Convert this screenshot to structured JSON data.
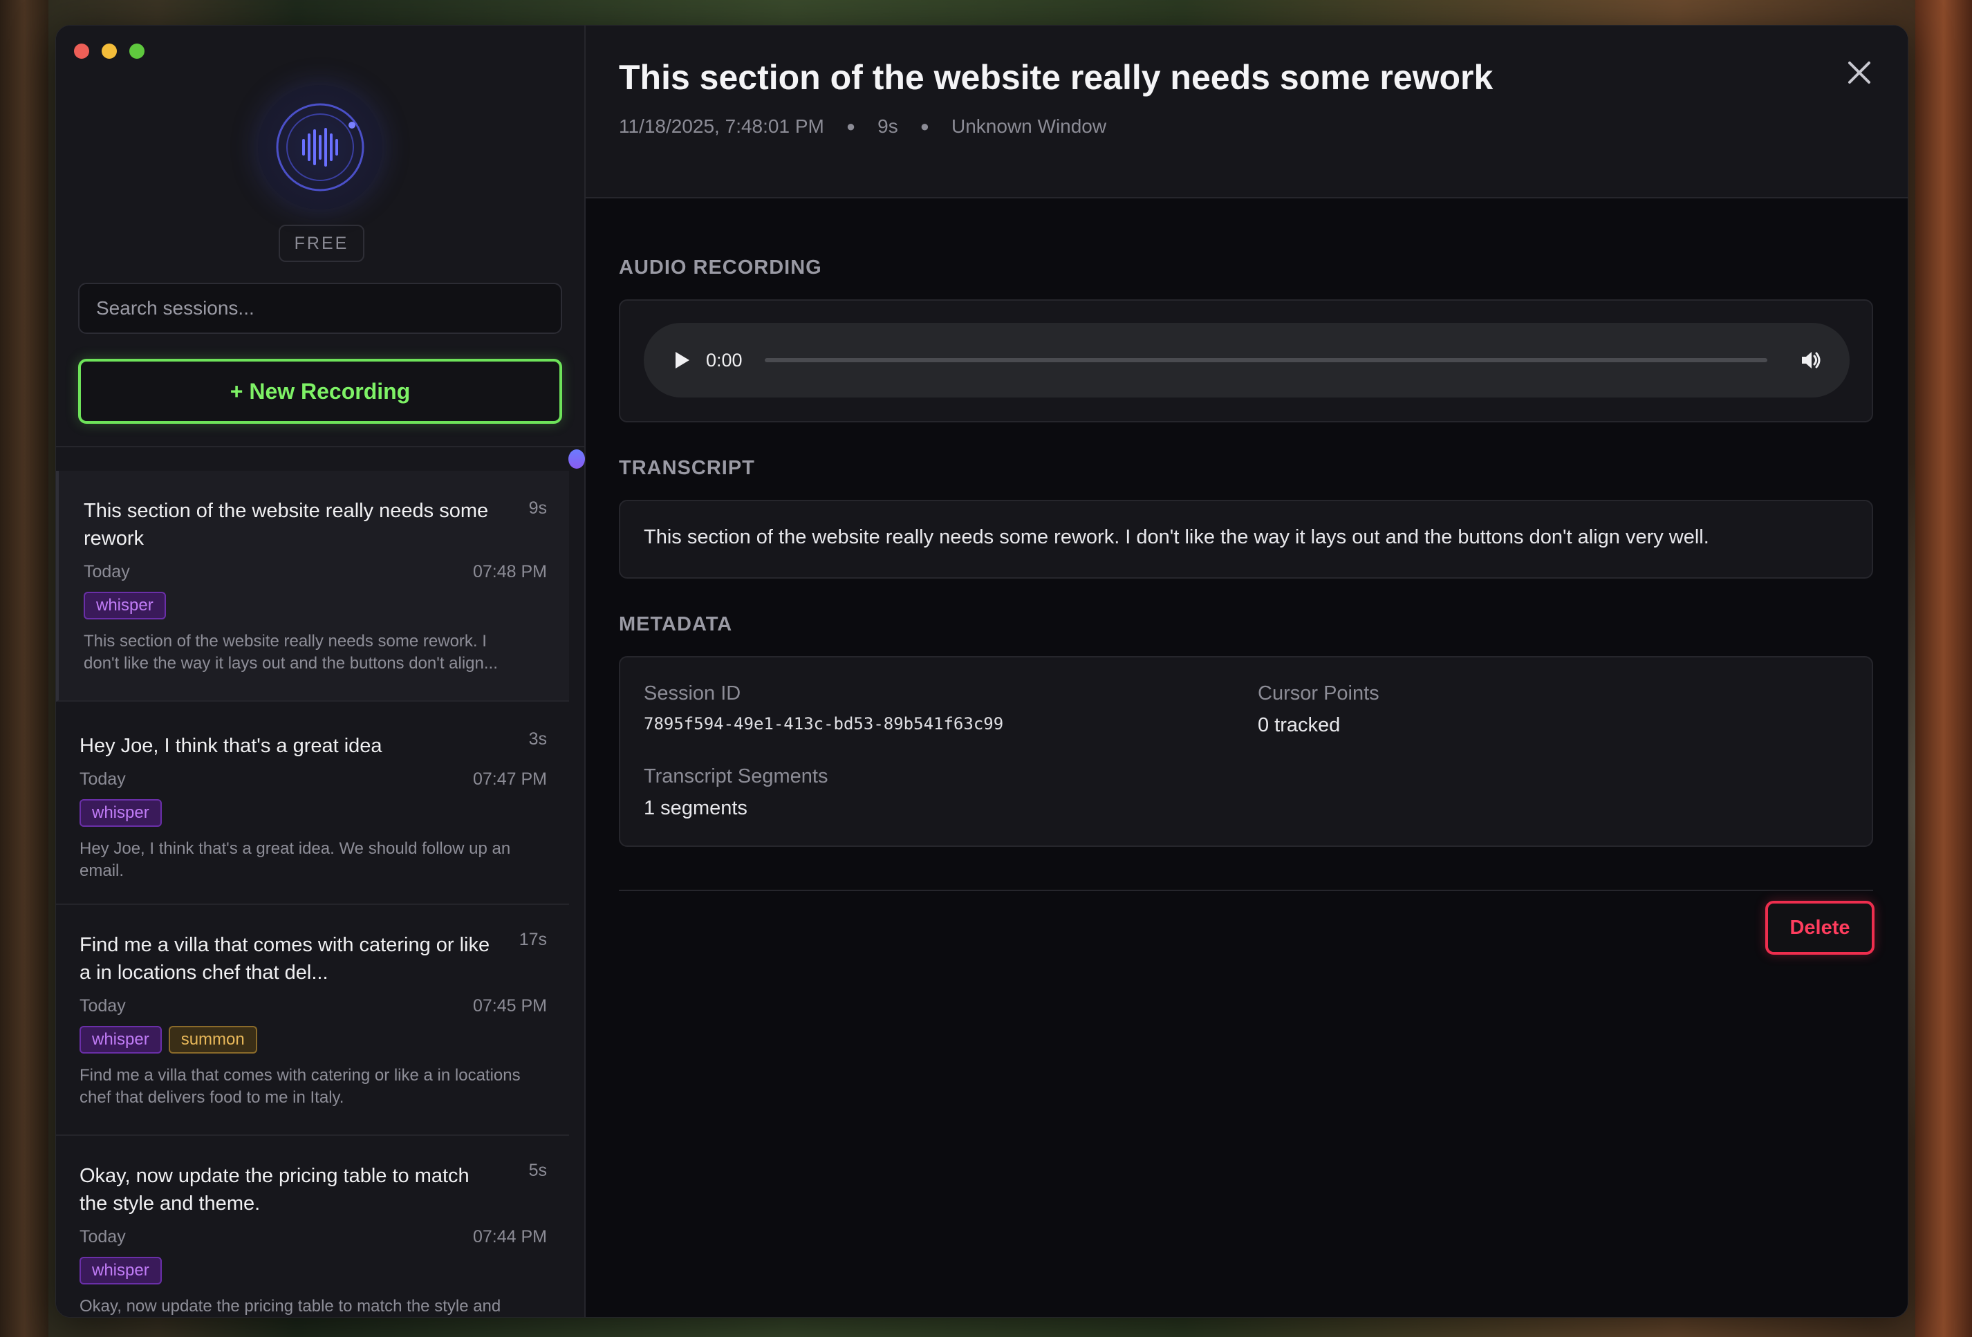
{
  "colors": {
    "accent_green": "#6ee35a",
    "danger": "#ee2e4e",
    "whisper_tag": "#c07cf6",
    "summon_tag": "#e8b85a"
  },
  "sidebar": {
    "plan_badge": "FREE",
    "search_placeholder": "Search sessions...",
    "new_recording_label": "+ New Recording",
    "sessions": [
      {
        "title": "This section of the website really needs some rework",
        "duration": "9s",
        "day": "Today",
        "time": "07:48 PM",
        "tags": [
          "whisper"
        ],
        "preview": "This section of the website really needs some rework. I don't like the way it lays out and the buttons don't align..."
      },
      {
        "title": "Hey Joe, I think that's a great idea",
        "duration": "3s",
        "day": "Today",
        "time": "07:47 PM",
        "tags": [
          "whisper"
        ],
        "preview": "Hey Joe, I think that's a great idea. We should follow up an email."
      },
      {
        "title": "Find me a villa that comes with catering or like a in locations chef that del...",
        "duration": "17s",
        "day": "Today",
        "time": "07:45 PM",
        "tags": [
          "whisper",
          "summon"
        ],
        "preview": "Find me a villa that comes with catering or like a in locations chef that delivers food to me in Italy."
      },
      {
        "title": "Okay, now update the pricing table to match the style and theme.",
        "duration": "5s",
        "day": "Today",
        "time": "07:44 PM",
        "tags": [
          "whisper"
        ],
        "preview": "Okay, now update the pricing table to match the style and theme."
      }
    ]
  },
  "detail": {
    "title": "This section of the website really needs some rework",
    "datetime": "11/18/2025, 7:48:01 PM",
    "duration": "9s",
    "window": "Unknown Window",
    "sections": {
      "audio": "AUDIO RECORDING",
      "transcript": "TRANSCRIPT",
      "metadata": "METADATA"
    },
    "player": {
      "time": "0:00",
      "progress": 0
    },
    "transcript": "This section of the website really needs some rework. I don't like the way it lays out and the buttons don't align very well.",
    "metadata": {
      "session_id_label": "Session ID",
      "session_id": "7895f594-49e1-413c-bd53-89b541f63c99",
      "cursor_points_label": "Cursor Points",
      "cursor_points": "0 tracked",
      "segments_label": "Transcript Segments",
      "segments": "1 segments"
    },
    "delete_label": "Delete"
  }
}
